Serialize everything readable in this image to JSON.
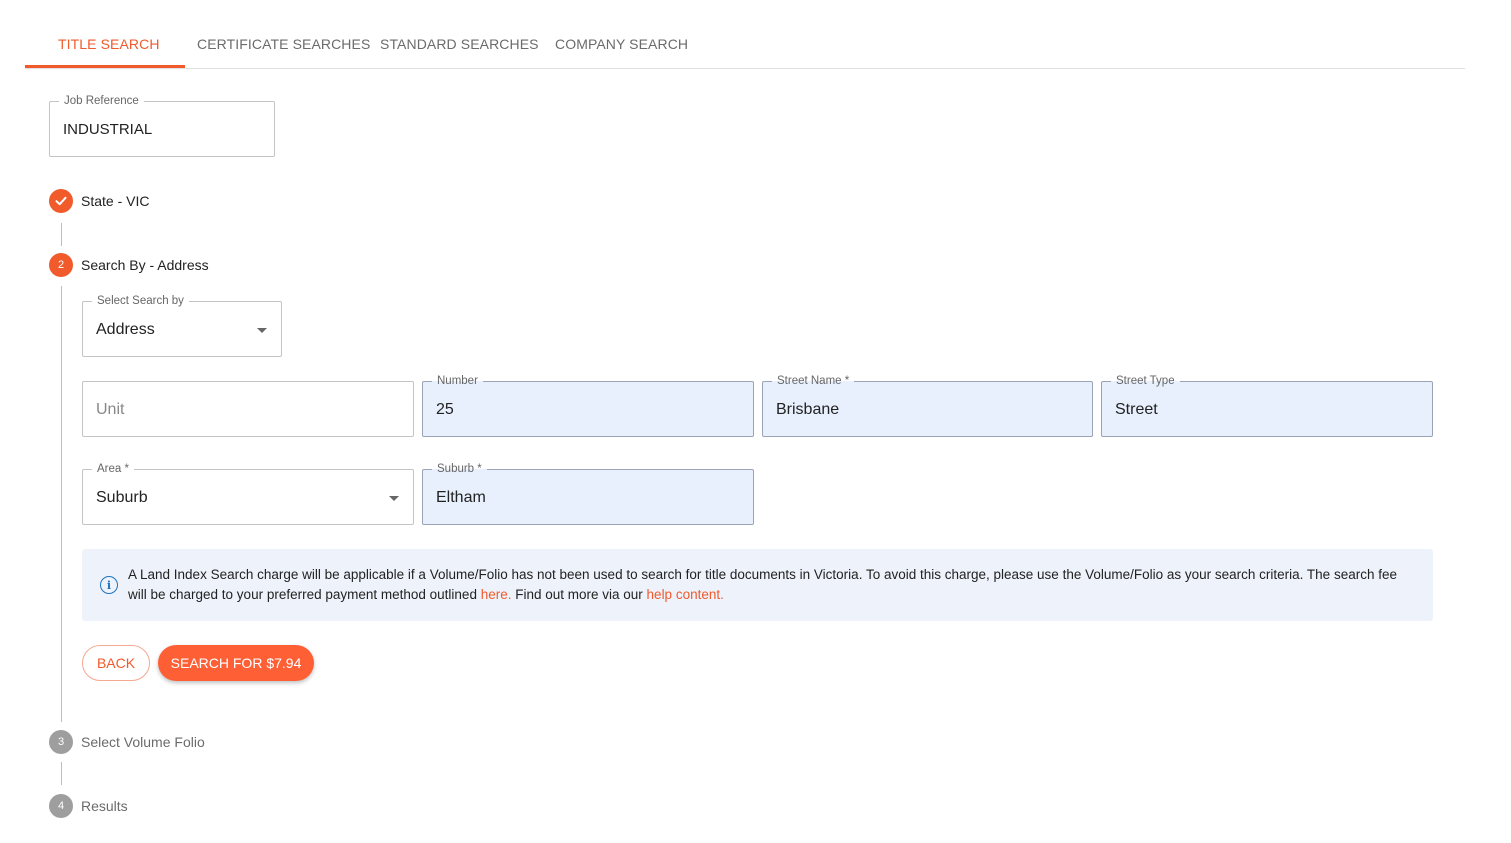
{
  "tabs": [
    {
      "label": "TITLE SEARCH"
    },
    {
      "label": "CERTIFICATE SEARCHES"
    },
    {
      "label": "STANDARD SEARCHES"
    },
    {
      "label": "COMPANY SEARCH"
    }
  ],
  "job_reference": {
    "label": "Job Reference",
    "value": "INDUSTRIAL"
  },
  "steps": [
    {
      "number": "",
      "label": "State - VIC",
      "status": "done"
    },
    {
      "number": "2",
      "label": "Search By - Address",
      "status": "active"
    },
    {
      "number": "3",
      "label": "Select Volume Folio",
      "status": "pending"
    },
    {
      "number": "4",
      "label": "Results",
      "status": "pending"
    }
  ],
  "form": {
    "search_by": {
      "label": "Select Search by",
      "value": "Address"
    },
    "unit": {
      "placeholder": "Unit"
    },
    "number": {
      "label": "Number",
      "value": "25"
    },
    "street_name": {
      "label": "Street Name *",
      "value": "Brisbane"
    },
    "street_type": {
      "label": "Street Type",
      "value": "Street"
    },
    "area": {
      "label": "Area *",
      "value": "Suburb"
    },
    "suburb": {
      "label": "Suburb *",
      "value": "Eltham"
    }
  },
  "info": {
    "text_before": "A Land Index Search charge will be applicable if a Volume/Folio has not been used to search for title documents in Victoria. To avoid this charge, please use the Volume/Folio as your search criteria. The search fee will be charged to your preferred payment method outlined ",
    "link1": "here.",
    "text_middle": " Find out more via our ",
    "link2": "help content."
  },
  "buttons": {
    "back": "BACK",
    "search": "SEARCH FOR $7.94"
  },
  "colors": {
    "accent": "#f15a2b",
    "filled_field": "#e8f0fe",
    "info_bg": "#eef3fb",
    "info_icon": "#1e73be"
  }
}
